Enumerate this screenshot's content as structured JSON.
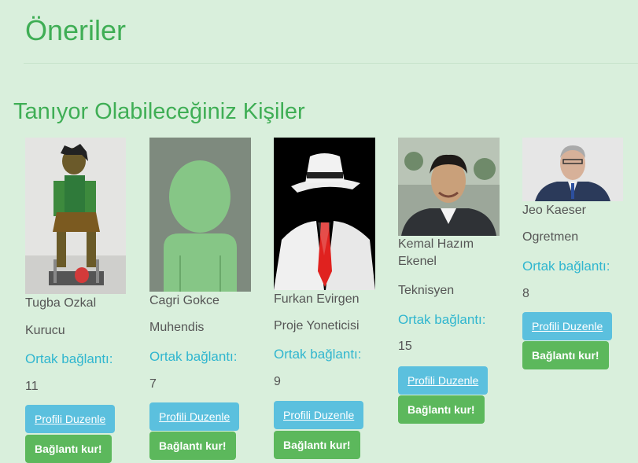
{
  "page_title": "Öneriler",
  "section_title": "Tanıyor Olabileceğiniz Kişiler",
  "people": [
    {
      "name": "Tugba Ozkal",
      "role": "Kurucu",
      "mutual_label": "Ortak bağlantı:",
      "mutual_count": "11",
      "edit_label": "Profili Duzenle",
      "connect_label": "Bağlantı kur!",
      "photo": "pencil-sculpture-photo"
    },
    {
      "name": "Cagri Gokce",
      "role": "Muhendis",
      "mutual_label": "Ortak bağlantı:",
      "mutual_count": "7",
      "edit_label": "Profili Duzenle",
      "connect_label": "Bağlantı kur!",
      "photo": "default-avatar"
    },
    {
      "name": "Furkan Evirgen",
      "role": "Proje Yoneticisi",
      "mutual_label": "Ortak bağlantı:",
      "mutual_count": "9",
      "edit_label": "Profili Duzenle",
      "connect_label": "Bağlantı kur!",
      "photo": "white-hat-silhouette"
    },
    {
      "name": "Kemal Hazım Ekenel",
      "role": "Teknisyen",
      "mutual_label": "Ortak bağlantı:",
      "mutual_count": "15",
      "edit_label": "Profili Duzenle",
      "connect_label": "Bağlantı kur!",
      "photo": "man-portrait-photo"
    },
    {
      "name": "Jeo Kaeser",
      "role": "Ogretmen",
      "mutual_label": "Ortak bağlantı:",
      "mutual_count": "8",
      "edit_label": "Profili Duzenle",
      "connect_label": "Bağlantı kur!",
      "photo": "man-suit-portrait-photo"
    }
  ],
  "colors": {
    "background": "#d9efdc",
    "heading": "#3fae55",
    "mutual_text": "#30b6cf",
    "info_button": "#5bc0de",
    "success_button": "#5cb85c"
  }
}
